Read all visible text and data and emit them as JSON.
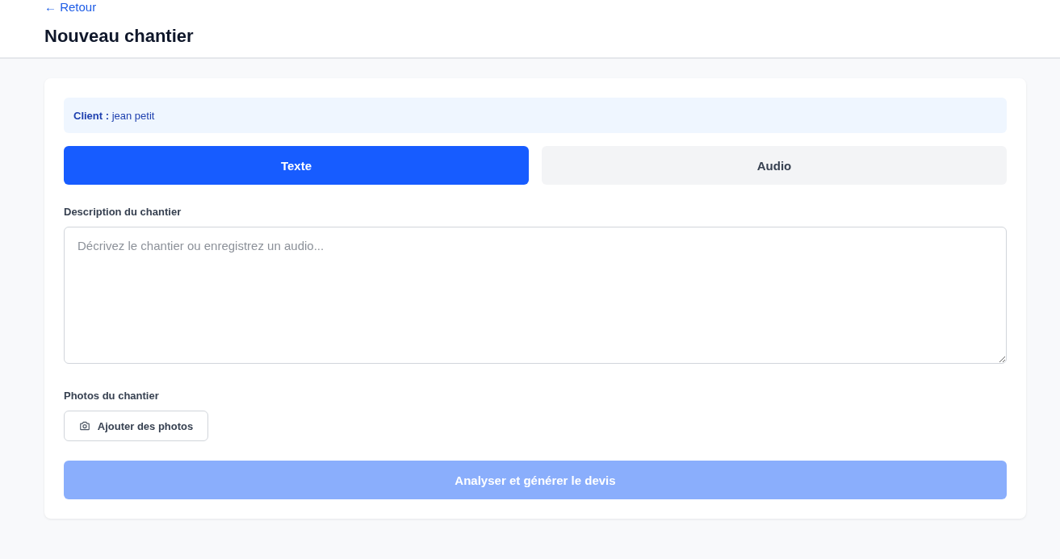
{
  "header": {
    "back_link": "← Retour",
    "title": "Nouveau chantier"
  },
  "client": {
    "text": "**Client :** jean petit"
  },
  "mode_tabs": [
    {
      "label": "Texte",
      "selected": true
    },
    {
      "label": "Audio",
      "selected": false
    }
  ],
  "description": {
    "label": "Description du chantier",
    "placeholder": "Décrivez le chantier ou enregistrez un audio..."
  },
  "photos": {
    "label": "Photos du chantier",
    "button": "Ajouter des photos"
  },
  "submit": {
    "label": "Analyser et générer le devis",
    "disabled": true
  }
}
